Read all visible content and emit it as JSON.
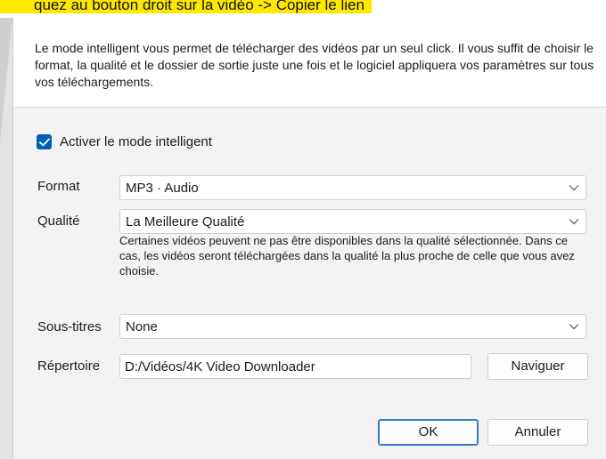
{
  "background": {
    "highlight_text": "quez au bouton droit sur la vidéo -> Copier le lien"
  },
  "dialog": {
    "info_text": "Le mode intelligent vous permet de télécharger des vidéos par un seul click. Il vous suffit de choisir le format, la qualité et le dossier de sortie juste une fois et le logiciel appliquera vos paramètres sur tous vos téléchargements.",
    "smart_mode": {
      "label": "Activer le mode intelligent",
      "checked": true
    },
    "format": {
      "label": "Format",
      "value": "MP3 · Audio"
    },
    "quality": {
      "label": "Qualité",
      "value": "La Meilleure Qualité"
    },
    "quality_hint": "Certaines vidéos peuvent ne pas être disponibles dans la qualité sélectionnée. Dans ce cas, les vidéos seront téléchargées dans la qualité la plus proche de celle que vous avez choisie.",
    "subtitles": {
      "label": "Sous-titres",
      "value": "None"
    },
    "directory": {
      "label": "Répertoire",
      "value": "D:/Vidéos/4K Video Downloader"
    },
    "buttons": {
      "browse": "Naviguer",
      "ok": "OK",
      "cancel": "Annuler"
    }
  },
  "colors": {
    "accent": "#005fb8",
    "highlight": "#ffe800",
    "dialog_bg": "#f3f3f3"
  },
  "icons": {
    "checkbox": "checkmark-icon",
    "dropdown": "chevron-down-icon"
  }
}
